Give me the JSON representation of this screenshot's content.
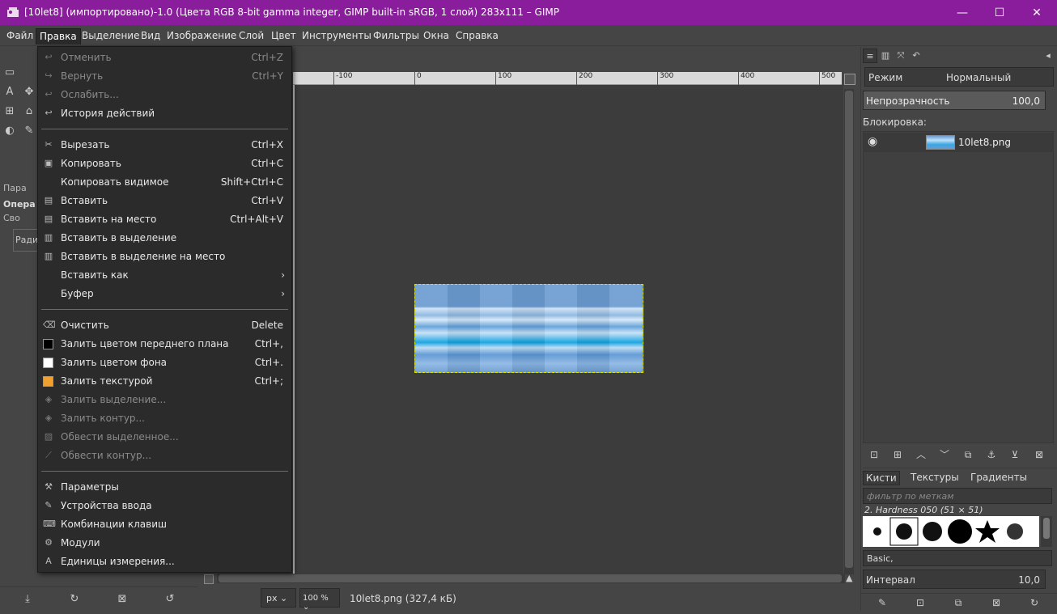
{
  "window": {
    "title": "[10let8] (импортировано)-1.0 (Цвета RGB 8-bit gamma integer, GIMP built-in sRGB, 1 слой) 283x111 – GIMP",
    "minimize": "—",
    "maximize": "☐",
    "close": "✕",
    "titlebar_color": "#8a1d9b"
  },
  "menubar": {
    "items": [
      "Файл",
      "Правка",
      "Выделение",
      "Вид",
      "Изображение",
      "Слой",
      "Цвет",
      "Инструменты",
      "Фильтры",
      "Окна",
      "Справка"
    ],
    "active": "Правка"
  },
  "edit_menu": {
    "items": [
      {
        "label": "Отменить",
        "shortcut": "Ctrl+Z",
        "icon": "undo-icon",
        "glyph": "↩",
        "disabled": true
      },
      {
        "label": "Вернуть",
        "shortcut": "Ctrl+Y",
        "icon": "redo-icon",
        "glyph": "↪",
        "disabled": true
      },
      {
        "label": "Ослабить...",
        "shortcut": "",
        "icon": "fade-icon",
        "glyph": "↩",
        "disabled": true
      },
      {
        "label": "История действий",
        "shortcut": "",
        "icon": "history-icon",
        "glyph": "↩",
        "disabled": false
      },
      {
        "label": "Вырезать",
        "shortcut": "Ctrl+X",
        "icon": "cut-icon",
        "glyph": "✂",
        "disabled": false
      },
      {
        "label": "Копировать",
        "shortcut": "Ctrl+C",
        "icon": "copy-icon",
        "glyph": "▣",
        "disabled": false
      },
      {
        "label": "Копировать видимое",
        "shortcut": "Shift+Ctrl+C",
        "icon": "",
        "glyph": "",
        "disabled": false
      },
      {
        "label": "Вставить",
        "shortcut": "Ctrl+V",
        "icon": "paste-icon",
        "glyph": "▤",
        "disabled": false
      },
      {
        "label": "Вставить на место",
        "shortcut": "Ctrl+Alt+V",
        "icon": "paste-in-place-icon",
        "glyph": "▤",
        "disabled": false
      },
      {
        "label": "Вставить в выделение",
        "shortcut": "",
        "icon": "paste-into-icon",
        "glyph": "▥",
        "disabled": false
      },
      {
        "label": "Вставить в выделение на место",
        "shortcut": "",
        "icon": "paste-into-in-place-icon",
        "glyph": "▥",
        "disabled": false
      },
      {
        "label": "Вставить как",
        "shortcut": "",
        "icon": "",
        "glyph": "",
        "disabled": false,
        "submenu": true
      },
      {
        "label": "Буфер",
        "shortcut": "",
        "icon": "",
        "glyph": "",
        "disabled": false,
        "submenu": true
      },
      {
        "label": "Очистить",
        "shortcut": "Delete",
        "icon": "clear-icon",
        "glyph": "⌫",
        "disabled": false
      },
      {
        "label": "Залить цветом переднего плана",
        "shortcut": "Ctrl+,",
        "icon": "fg-fill-icon",
        "glyph": "",
        "swatch": "#000000",
        "disabled": false
      },
      {
        "label": "Залить цветом фона",
        "shortcut": "Ctrl+.",
        "icon": "bg-fill-icon",
        "glyph": "",
        "swatch": "#ffffff",
        "disabled": false
      },
      {
        "label": "Залить текстурой",
        "shortcut": "Ctrl+;",
        "icon": "pattern-fill-icon",
        "glyph": "",
        "swatch": "#f0a030",
        "disabled": false
      },
      {
        "label": "Залить выделение...",
        "shortcut": "",
        "icon": "fill-selection-icon",
        "glyph": "◈",
        "disabled": true
      },
      {
        "label": "Залить контур...",
        "shortcut": "",
        "icon": "fill-path-icon",
        "glyph": "◈",
        "disabled": true
      },
      {
        "label": "Обвести выделенное...",
        "shortcut": "",
        "icon": "stroke-selection-icon",
        "glyph": "▨",
        "disabled": true
      },
      {
        "label": "Обвести контур...",
        "shortcut": "",
        "icon": "stroke-path-icon",
        "glyph": "⟋",
        "disabled": true
      },
      {
        "label": "Параметры",
        "shortcut": "",
        "icon": "preferences-icon",
        "glyph": "⚒",
        "disabled": false
      },
      {
        "label": "Устройства ввода",
        "shortcut": "",
        "icon": "input-devices-icon",
        "glyph": "✎",
        "disabled": false
      },
      {
        "label": "Комбинации клавиш",
        "shortcut": "",
        "icon": "keyboard-icon",
        "glyph": "⌨",
        "disabled": false
      },
      {
        "label": "Модули",
        "shortcut": "",
        "icon": "modules-icon",
        "glyph": "⚙",
        "disabled": false
      },
      {
        "label": "Единицы измерения...",
        "shortcut": "",
        "icon": "units-icon",
        "glyph": "A",
        "disabled": false
      }
    ]
  },
  "left_dock": {
    "tab_label": "Пара",
    "ops_label": "Опера",
    "svo_label": "Сво",
    "rad_label": "Ради"
  },
  "ruler": {
    "ticks": [
      "-100",
      "0",
      "100",
      "200",
      "300",
      "400",
      "500"
    ]
  },
  "statusbar": {
    "unit": "px",
    "zoom": "100 %",
    "info": "10let8.png (327,4 кБ)"
  },
  "layers": {
    "mode_label": "Режим",
    "mode_value": "Нормальный",
    "opacity_label": "Непрозрачность",
    "opacity_value": "100,0",
    "lock_label": "Блокировка:",
    "layer_name": "10let8.png"
  },
  "brushes": {
    "tabs": [
      "Кисти",
      "Текстуры",
      "Градиенты"
    ],
    "filter_placeholder": "фильтр по меткам",
    "selected_brush": "2. Hardness 050 (51 × 51)",
    "brush_set": "Basic,",
    "spacing_label": "Интервал",
    "spacing_value": "10,0"
  }
}
